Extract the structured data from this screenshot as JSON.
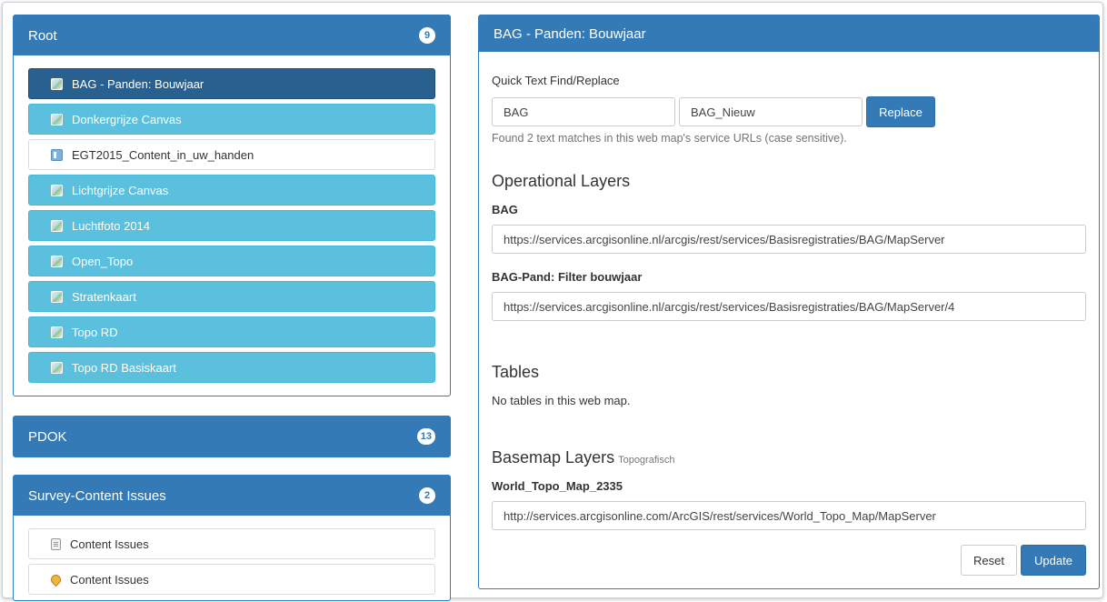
{
  "left": {
    "root": {
      "title": "Root",
      "count": "9",
      "items": [
        {
          "label": "BAG - Panden: Bouwjaar",
          "style": "active",
          "icon": "map-icon"
        },
        {
          "label": "Donkergrijze Canvas",
          "style": "light",
          "icon": "map-icon"
        },
        {
          "label": "EGT2015_Content_in_uw_handen",
          "style": "plain",
          "icon": "dashboard-icon"
        },
        {
          "label": "Lichtgrijze Canvas",
          "style": "light",
          "icon": "map-icon"
        },
        {
          "label": "Luchtfoto 2014",
          "style": "light",
          "icon": "map-icon"
        },
        {
          "label": "Open_Topo",
          "style": "light",
          "icon": "map-icon"
        },
        {
          "label": "Stratenkaart",
          "style": "light",
          "icon": "map-icon"
        },
        {
          "label": "Topo RD",
          "style": "light",
          "icon": "map-icon"
        },
        {
          "label": "Topo RD Basiskaart",
          "style": "light",
          "icon": "map-icon"
        }
      ]
    },
    "pdok": {
      "title": "PDOK",
      "count": "13"
    },
    "survey": {
      "title": "Survey-Content Issues",
      "count": "2",
      "items": [
        {
          "label": "Content Issues",
          "icon": "document-icon"
        },
        {
          "label": "Content Issues",
          "icon": "map-pin-icon"
        }
      ]
    }
  },
  "right": {
    "title": "BAG - Panden: Bouwjaar",
    "quick_find": {
      "label": "Quick Text Find/Replace",
      "find_value": "BAG",
      "replace_value": "BAG_Nieuw",
      "button": "Replace",
      "help": "Found 2 text matches in this web map's service URLs (case sensitive)."
    },
    "operational": {
      "heading": "Operational Layers",
      "layers": [
        {
          "name": "BAG",
          "url": "https://services.arcgisonline.nl/arcgis/rest/services/Basisregistraties/BAG/MapServer"
        },
        {
          "name": "BAG-Pand: Filter bouwjaar",
          "url": "https://services.arcgisonline.nl/arcgis/rest/services/Basisregistraties/BAG/MapServer/4"
        }
      ]
    },
    "tables": {
      "heading": "Tables",
      "empty_text": "No tables in this web map."
    },
    "basemap": {
      "heading": "Basemap Layers",
      "sub": "Topografisch",
      "layer_name": "World_Topo_Map_2335",
      "url": "http://services.arcgisonline.com/ArcGIS/rest/services/World_Topo_Map/MapServer"
    },
    "buttons": {
      "reset": "Reset",
      "update": "Update"
    }
  },
  "colors": {
    "primary": "#337ab7",
    "info": "#5bc0de",
    "active": "#286090"
  }
}
